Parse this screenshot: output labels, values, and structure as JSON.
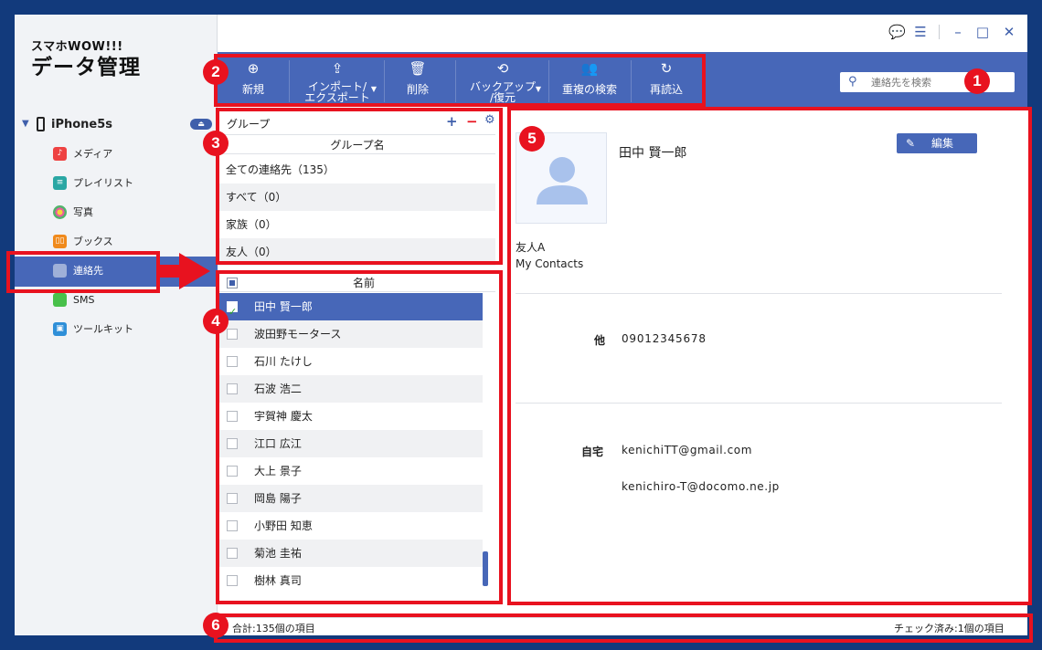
{
  "app": {
    "brand_top": "スマホWOW!!!",
    "brand_bottom": "データ管理"
  },
  "sidebar": {
    "device": "iPhone5s",
    "items": [
      {
        "label": "メディア",
        "icon": "music-icon"
      },
      {
        "label": "プレイリスト",
        "icon": "playlist-icon"
      },
      {
        "label": "写真",
        "icon": "photos-icon"
      },
      {
        "label": "ブックス",
        "icon": "books-icon"
      },
      {
        "label": "連絡先",
        "icon": "contacts-icon",
        "active": true
      },
      {
        "label": "SMS",
        "icon": "sms-icon"
      },
      {
        "label": "ツールキット",
        "icon": "toolkit-icon"
      }
    ]
  },
  "toolbar": {
    "buttons": [
      {
        "label": "新規",
        "icon": "plus-circle-icon"
      },
      {
        "label": "インポート/\nエクスポート",
        "icon": "import-export-icon",
        "dropdown": true
      },
      {
        "label": "削除",
        "icon": "trash-icon"
      },
      {
        "label": "バックアップ\n/復元",
        "icon": "backup-icon",
        "dropdown": true
      },
      {
        "label": "重複の検索",
        "icon": "duplicate-icon"
      },
      {
        "label": "再読込",
        "icon": "refresh-icon"
      }
    ],
    "search_placeholder": "連絡先を検索"
  },
  "groups": {
    "title": "グループ",
    "column": "グループ名",
    "rows": [
      "全ての連絡先（135）",
      "すべて（0）",
      "家族（0）",
      "友人（0）"
    ]
  },
  "contacts": {
    "column": "名前",
    "rows": [
      {
        "name": "田中 賢一郎",
        "checked": true,
        "selected": true
      },
      {
        "name": "波田野モータース",
        "checked": false
      },
      {
        "name": "石川 たけし",
        "checked": false
      },
      {
        "name": "石波 浩二",
        "checked": false
      },
      {
        "name": "宇賀神 慶太",
        "checked": false
      },
      {
        "name": "江口 広江",
        "checked": false
      },
      {
        "name": "大上 景子",
        "checked": false
      },
      {
        "name": "岡島 陽子",
        "checked": false
      },
      {
        "name": "小野田 知恵",
        "checked": false
      },
      {
        "name": "菊池 圭祐",
        "checked": false
      },
      {
        "name": "樹林 真司",
        "checked": false
      }
    ]
  },
  "detail": {
    "name": "田中 賢一郎",
    "edit_label": "編集",
    "group": "友人A",
    "account": "My Contacts",
    "phone_label": "他",
    "phone": "09012345678",
    "email_label": "自宅",
    "email1": "kenichiTT@gmail.com",
    "email2": "kenichiro-T@docomo.ne.jp"
  },
  "status": {
    "total": "合計:135個の項目",
    "checked": "チェック済み:1個の項目"
  },
  "annotations": [
    "1",
    "2",
    "3",
    "4",
    "5",
    "6"
  ],
  "colors": {
    "accent": "#4767b8",
    "annotation": "#e8121f",
    "background": "#123a7c"
  }
}
